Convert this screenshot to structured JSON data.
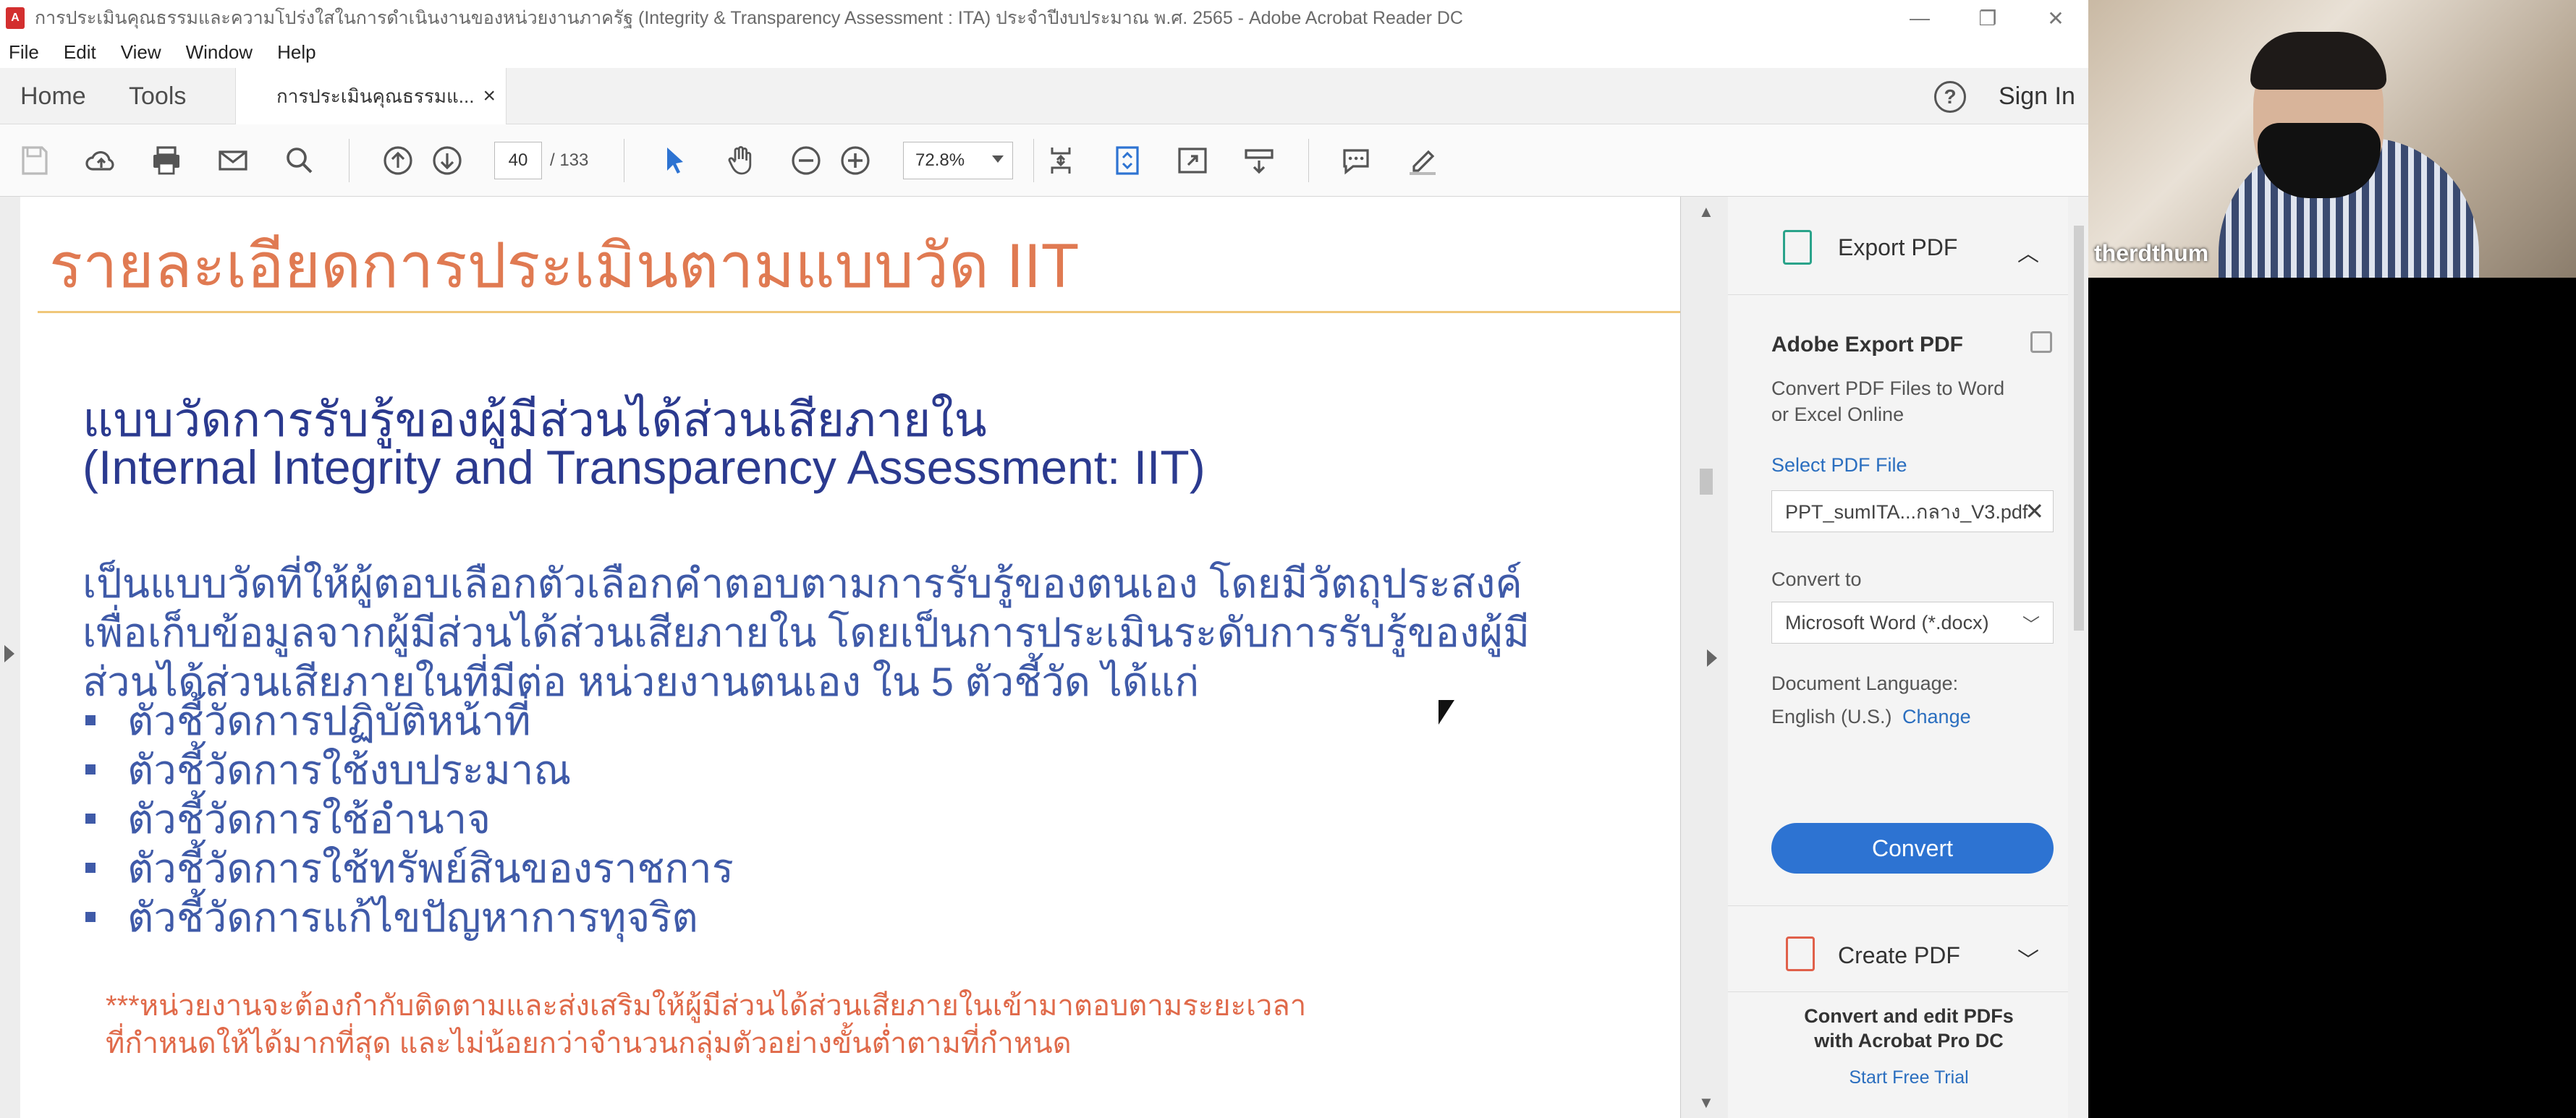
{
  "window": {
    "title": "การประเมินคุณธรรมและความโปร่งใสในการดำเนินงานของหน่วยงานภาครัฐ (Integrity & Transparency Assessment : ITA) ประจำปีงบประมาณ พ.ศ. 2565 - Adobe Acrobat Reader DC",
    "minimize": "—",
    "restore": "❐",
    "close": "✕"
  },
  "menu": [
    "File",
    "Edit",
    "View",
    "Window",
    "Help"
  ],
  "tabs": {
    "home": "Home",
    "tools": "Tools",
    "document": "การประเมินคุณธรรมแ...",
    "close": "×",
    "help": "?",
    "sign_in": "Sign In"
  },
  "toolbar": {
    "page_current": "40",
    "page_total": "/ 133",
    "zoom": "72.8%"
  },
  "page": {
    "title": "รายละเอียดการประเมินตามแบบวัด IIT",
    "heading_th": "แบบวัดการรับรู้ของผู้มีส่วนได้ส่วนเสียภายใน",
    "heading_en": "(Internal Integrity and Transparency Assessment: IIT)",
    "body_lines": [
      "เป็นแบบวัดที่ให้ผู้ตอบเลือกตัวเลือกคำตอบตามการรับรู้ของตนเอง โดยมีวัตถุประสงค์",
      "เพื่อเก็บข้อมูลจากผู้มีส่วนได้ส่วนเสียภายใน โดยเป็นการประเมินระดับการรับรู้ของผู้มี",
      "ส่วนได้ส่วนเสียภายในที่มีต่อ หน่วยงานตนเอง ใน 5 ตัวชี้วัด ได้แก่"
    ],
    "bullets": [
      "ตัวชี้วัดการปฏิบัติหน้าที่",
      "ตัวชี้วัดการใช้งบประมาณ",
      "ตัวชี้วัดการใช้อำนาจ",
      "ตัวชี้วัดการใช้ทรัพย์สินของราชการ",
      "ตัวชี้วัดการแก้ไขปัญหาการทุจริต"
    ],
    "note_lines": [
      "***หน่วยงานจะต้องกำกับติดตามและส่งเสริมให้ผู้มีส่วนได้ส่วนเสียภายในเข้ามาตอบตามระยะเวลา",
      "ที่กำหนดให้ได้มากที่สุด และไม่น้อยกว่าจำนวนกลุ่มตัวอย่างขั้นต่ำตามที่กำหนด"
    ]
  },
  "right_pane": {
    "export_title": "Export PDF",
    "service_title": "Adobe Export PDF",
    "service_desc_1": "Convert PDF Files to Word",
    "service_desc_2": "or Excel Online",
    "select_file_label": "Select PDF File",
    "file_name": "PPT_sumITA...กลาง_V3.pdf",
    "convert_to_label": "Convert to",
    "convert_to_value": "Microsoft Word (*.docx)",
    "doc_lang_label": "Document Language:",
    "doc_lang_value": "English (U.S.)",
    "doc_lang_change": "Change",
    "convert_button": "Convert",
    "create_title": "Create PDF",
    "promo_1": "Convert and edit PDFs",
    "promo_2": "with Acrobat Pro DC",
    "promo_link": "Start Free Trial"
  },
  "video": {
    "participant_name": "therdthum"
  },
  "colors": {
    "page_title": "#e07a52",
    "heading_blue": "#2b3a8f",
    "body_blue": "#3f5aa8",
    "note_red": "#e06a4a",
    "convert_button": "#2d73d2"
  }
}
